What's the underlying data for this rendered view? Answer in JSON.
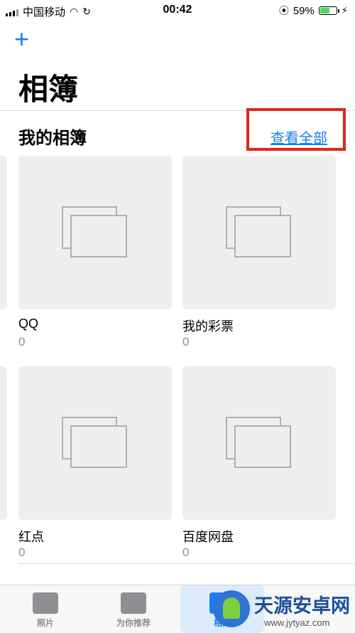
{
  "status_bar": {
    "carrier": "中国移动",
    "time": "00:42",
    "battery_percent": "59%",
    "battery_level": 0.59
  },
  "header": {
    "add_icon": "plus-icon",
    "title": "相簿"
  },
  "section": {
    "title": "我的相簿",
    "see_all": "查看全部"
  },
  "albums": [
    {
      "name": "QQ",
      "count": "0"
    },
    {
      "name": "我的彩票",
      "count": "0"
    },
    {
      "name": "红点",
      "count": "0"
    },
    {
      "name": "百度网盘",
      "count": "0"
    }
  ],
  "tabs": [
    {
      "label": "照片",
      "icon": "photos-icon"
    },
    {
      "label": "为你推荐",
      "icon": "for-you-icon"
    },
    {
      "label": "相簿",
      "icon": "albums-icon",
      "active": true
    }
  ],
  "watermark": {
    "name": "天源安卓网",
    "url": "www.jytyaz.com"
  },
  "colors": {
    "accent": "#1a7ef2",
    "highlight": "#e0261b"
  }
}
